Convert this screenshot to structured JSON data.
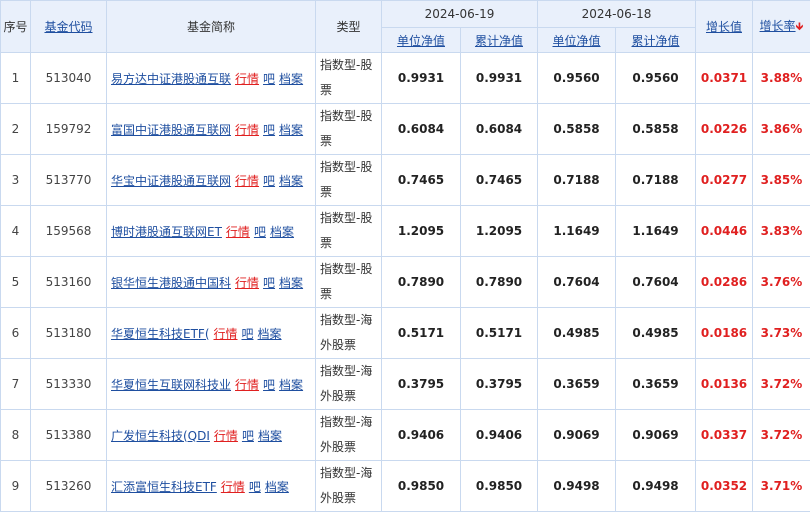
{
  "header": {
    "seq": "序号",
    "code": "基金代码",
    "name": "基金简称",
    "type": "类型",
    "date1": "2024-06-19",
    "date2": "2024-06-18",
    "unit_nav": "单位净值",
    "acc_nav": "累计净值",
    "growth_value": "增长值",
    "growth_rate": "增长率",
    "sort_icon": "arrow-down-icon"
  },
  "link_labels": {
    "quote": "行情",
    "bar": "吧",
    "archive": "档案"
  },
  "colors": {
    "header_bg": "#e9f0fb",
    "border": "#c9d9ef",
    "link": "#1f4fa0",
    "red": "#e02020"
  },
  "rows": [
    {
      "seq": "1",
      "code": "513040",
      "name": "易方达中证港股通互联",
      "type": "指数型-股票",
      "unit1": "0.9931",
      "acc1": "0.9931",
      "unit2": "0.9560",
      "acc2": "0.9560",
      "gv": "0.0371",
      "gr": "3.88%"
    },
    {
      "seq": "2",
      "code": "159792",
      "name": "富国中证港股通互联网",
      "type": "指数型-股票",
      "unit1": "0.6084",
      "acc1": "0.6084",
      "unit2": "0.5858",
      "acc2": "0.5858",
      "gv": "0.0226",
      "gr": "3.86%"
    },
    {
      "seq": "3",
      "code": "513770",
      "name": "华宝中证港股通互联网",
      "type": "指数型-股票",
      "unit1": "0.7465",
      "acc1": "0.7465",
      "unit2": "0.7188",
      "acc2": "0.7188",
      "gv": "0.0277",
      "gr": "3.85%"
    },
    {
      "seq": "4",
      "code": "159568",
      "name": "博时港股通互联网ET",
      "type": "指数型-股票",
      "unit1": "1.2095",
      "acc1": "1.2095",
      "unit2": "1.1649",
      "acc2": "1.1649",
      "gv": "0.0446",
      "gr": "3.83%"
    },
    {
      "seq": "5",
      "code": "513160",
      "name": "银华恒生港股通中国科",
      "type": "指数型-股票",
      "unit1": "0.7890",
      "acc1": "0.7890",
      "unit2": "0.7604",
      "acc2": "0.7604",
      "gv": "0.0286",
      "gr": "3.76%"
    },
    {
      "seq": "6",
      "code": "513180",
      "name": "华夏恒生科技ETF(",
      "type": "指数型-海外股票",
      "unit1": "0.5171",
      "acc1": "0.5171",
      "unit2": "0.4985",
      "acc2": "0.4985",
      "gv": "0.0186",
      "gr": "3.73%"
    },
    {
      "seq": "7",
      "code": "513330",
      "name": "华夏恒生互联网科技业",
      "type": "指数型-海外股票",
      "unit1": "0.3795",
      "acc1": "0.3795",
      "unit2": "0.3659",
      "acc2": "0.3659",
      "gv": "0.0136",
      "gr": "3.72%"
    },
    {
      "seq": "8",
      "code": "513380",
      "name": "广发恒生科技(QDI",
      "type": "指数型-海外股票",
      "unit1": "0.9406",
      "acc1": "0.9406",
      "unit2": "0.9069",
      "acc2": "0.9069",
      "gv": "0.0337",
      "gr": "3.72%"
    },
    {
      "seq": "9",
      "code": "513260",
      "name": "汇添富恒生科技ETF",
      "type": "指数型-海外股票",
      "unit1": "0.9850",
      "acc1": "0.9850",
      "unit2": "0.9498",
      "acc2": "0.9498",
      "gv": "0.0352",
      "gr": "3.71%"
    }
  ]
}
